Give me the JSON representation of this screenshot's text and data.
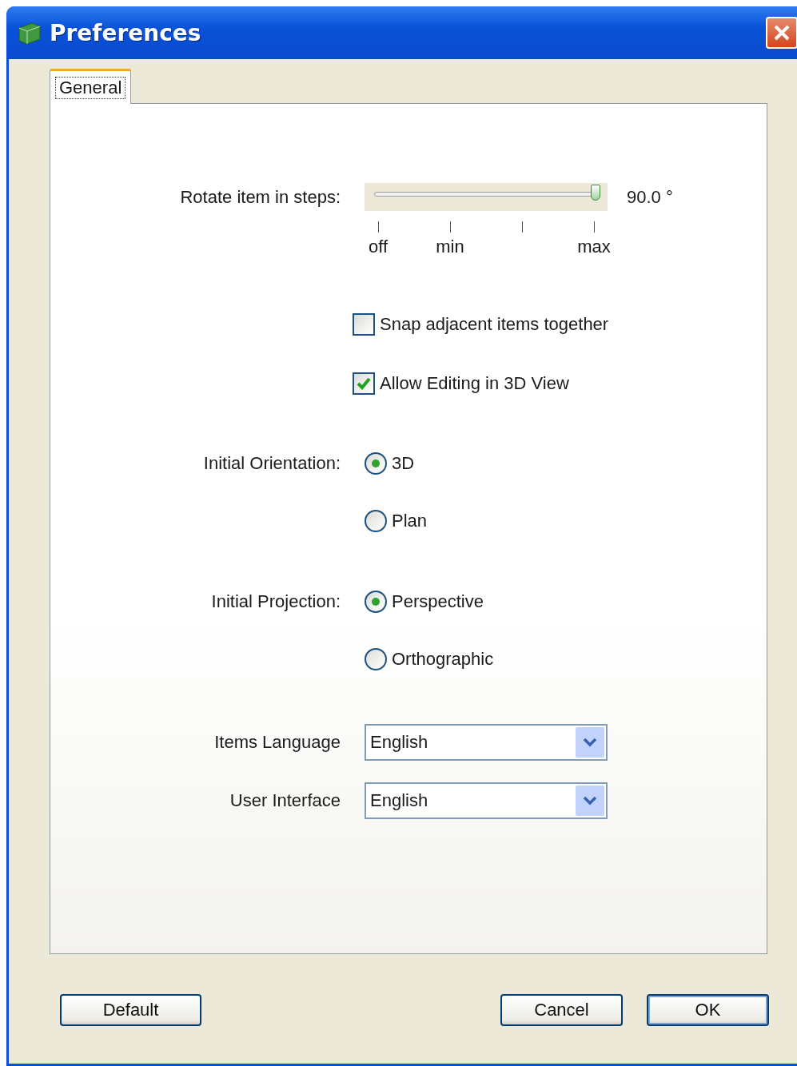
{
  "window": {
    "title": "Preferences"
  },
  "tabs": [
    {
      "label": "General",
      "selected": true
    }
  ],
  "rotate": {
    "label": "Rotate item in steps:",
    "level": 1,
    "reading": "90.0 °",
    "tick_labels": [
      "off",
      "min",
      "max"
    ]
  },
  "checkboxes": [
    {
      "label": "Snap adjacent items together",
      "checked": false
    },
    {
      "label": "Allow Editing in 3D View",
      "checked": true
    }
  ],
  "radio_groups": [
    {
      "label": "Initial Orientation:",
      "options": [
        {
          "label": "3D",
          "selected": true
        },
        {
          "label": "Plan",
          "selected": false
        }
      ]
    },
    {
      "label": "Initial Projection:",
      "options": [
        {
          "label": "Perspective",
          "selected": true
        },
        {
          "label": "Orthographic",
          "selected": false
        }
      ]
    }
  ],
  "dropdowns": [
    {
      "label": "Items Language",
      "value": "English"
    },
    {
      "label": "User Interface",
      "value": "English"
    }
  ],
  "buttons": [
    {
      "label": "Default",
      "default": false
    },
    {
      "label": "Cancel",
      "default": false
    },
    {
      "label": "OK",
      "default": true
    }
  ]
}
